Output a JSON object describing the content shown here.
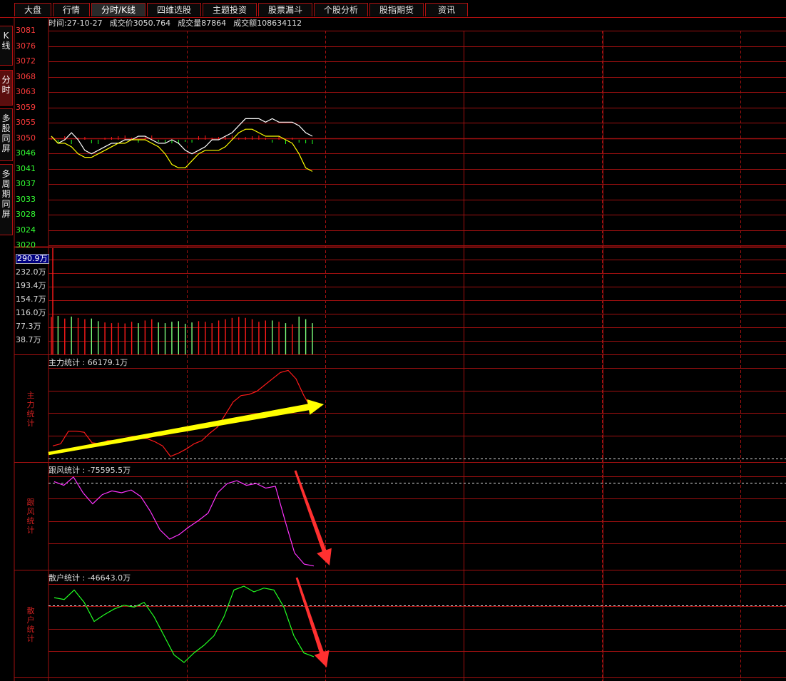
{
  "tabs": [
    {
      "label": "大盘",
      "active": false
    },
    {
      "label": "行情",
      "active": false
    },
    {
      "label": "分时/K线",
      "active": true
    },
    {
      "label": "四维选股",
      "active": false
    },
    {
      "label": "主题投资",
      "active": false
    },
    {
      "label": "股票漏斗",
      "active": false
    },
    {
      "label": "个股分析",
      "active": false
    },
    {
      "label": "股指期货",
      "active": false
    },
    {
      "label": "资讯",
      "active": false
    }
  ],
  "side_tabs": [
    {
      "label": "K\n线",
      "active": false
    },
    {
      "label": "分\n时",
      "active": true
    },
    {
      "label": "多\n股\n同\n屏",
      "active": false
    },
    {
      "label": "多\n周\n期\n同\n屏",
      "active": false
    }
  ],
  "info": {
    "time": "时间:27-10-27",
    "price": "成交价3050.764",
    "volume": "成交量87864",
    "amount": "成交额108634112"
  },
  "price_axis": {
    "labels": [
      "3081",
      "3076",
      "3072",
      "3068",
      "3063",
      "3059",
      "3055",
      "3050",
      "3046",
      "3041",
      "3037",
      "3033",
      "3028",
      "3024",
      "3020"
    ],
    "base": 3050,
    "up_color": "#ff3b3b",
    "down_color": "#33ff33"
  },
  "volume_axis": {
    "labels": [
      "290.9万",
      "232.0万",
      "193.4万",
      "154.7万",
      "116.0万",
      "77.3万",
      "38.7万"
    ]
  },
  "panels": {
    "main_force": {
      "title": "主力统计 : 66179.1万",
      "side_label": "主力统计"
    },
    "follow": {
      "title": "跟风统计 : -75595.5万",
      "side_label": "跟风统计"
    },
    "retail": {
      "title": "散户统计 : -46643.0万",
      "side_label": "散户统计"
    }
  },
  "colors": {
    "grid": "#a01010",
    "price_line": "#ffffff",
    "avg_line": "#ffff00",
    "main_force": "#ff1a1a",
    "follow": "#ff33ff",
    "retail": "#22ff22",
    "arrow_up": "#ffff00",
    "arrow_down": "#ff3030"
  },
  "series": {
    "price": [
      3051,
      3049,
      3050,
      3052,
      3050,
      3047,
      3046,
      3047,
      3048,
      3049,
      3049,
      3050,
      3050,
      3051,
      3051,
      3050,
      3049,
      3049,
      3050,
      3049,
      3047,
      3046,
      3047,
      3048,
      3050,
      3050,
      3051,
      3052,
      3054,
      3056,
      3056,
      3056,
      3055,
      3056,
      3055,
      3055,
      3055,
      3054,
      3052,
      3051
    ],
    "avg": [
      3051,
      3049,
      3049,
      3048,
      3046,
      3045,
      3045,
      3046,
      3047,
      3048,
      3049,
      3049,
      3050,
      3050,
      3050,
      3049,
      3048,
      3046,
      3043,
      3042,
      3042,
      3044,
      3046,
      3047,
      3047,
      3047,
      3048,
      3050,
      3052,
      3053,
      3053,
      3052,
      3051,
      3051,
      3051,
      3050,
      3049,
      3046,
      3042,
      3041
    ],
    "bar_dir": [
      1,
      -1,
      1,
      -1,
      1,
      1,
      -1,
      -1,
      1,
      1,
      1,
      1,
      1,
      -1,
      1,
      1,
      -1,
      -1,
      -1,
      -1,
      -1,
      -1,
      1,
      1,
      1,
      1,
      1,
      1,
      1,
      1,
      1,
      1,
      1,
      -1,
      1,
      -1,
      1,
      -1,
      -1,
      -1
    ],
    "volume": [
      115,
      118,
      110,
      116,
      112,
      108,
      110,
      102,
      98,
      96,
      97,
      95,
      100,
      96,
      104,
      108,
      98,
      96,
      100,
      102,
      94,
      98,
      102,
      100,
      96,
      104,
      108,
      112,
      115,
      112,
      108,
      100,
      104,
      104,
      100,
      96,
      92,
      116,
      108,
      96
    ],
    "main_force": [
      10,
      12,
      24,
      24,
      23,
      13,
      12,
      15,
      15,
      16,
      16,
      17,
      17,
      14,
      10,
      0,
      3,
      7,
      12,
      15,
      22,
      28,
      40,
      52,
      58,
      59,
      62,
      68,
      74,
      80,
      82,
      74,
      58,
      45
    ],
    "follow": [
      92,
      88,
      97,
      80,
      68,
      78,
      82,
      80,
      83,
      76,
      60,
      40,
      30,
      35,
      43,
      50,
      58,
      80,
      90,
      93,
      88,
      90,
      85,
      87,
      50,
      15,
      3,
      1
    ],
    "retail": [
      80,
      78,
      88,
      75,
      55,
      62,
      68,
      72,
      70,
      75,
      60,
      40,
      20,
      12,
      22,
      30,
      40,
      60,
      88,
      92,
      86,
      90,
      88,
      70,
      40,
      22,
      18
    ]
  },
  "annotations": {
    "main_arrow": "up",
    "follow_arrow": "down",
    "retail_arrow": "down"
  }
}
